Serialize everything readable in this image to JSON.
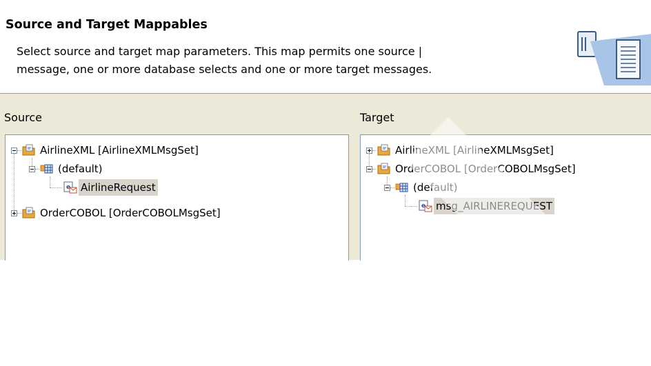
{
  "header": {
    "title": "Source and Target Mappables",
    "description_line1": "Select source and target map parameters. This map permits one source |",
    "description_line2": "message, one or more database selects and one or more target messages."
  },
  "source": {
    "label": "Source",
    "nodes": [
      {
        "label": "AirlineXML [AirlineXMLMsgSet]",
        "icon": "message-set-icon",
        "expander": "minus"
      },
      {
        "label": "(default)",
        "icon": "message-category-icon",
        "expander": "minus"
      },
      {
        "label": "AirlineRequest",
        "icon": "message-icon",
        "selected": true
      },
      {
        "label": "OrderCOBOL [OrderCOBOLMsgSet]",
        "icon": "message-set-icon",
        "expander": "plus"
      }
    ]
  },
  "target": {
    "label": "Target",
    "nodes": [
      {
        "label": "AirlineXML [AirlineXMLMsgSet]",
        "icon": "message-set-icon",
        "expander": "plus"
      },
      {
        "label": "OrderCOBOL [OrderCOBOLMsgSet]",
        "icon": "message-set-icon",
        "expander": "minus"
      },
      {
        "label": "(default)",
        "icon": "message-category-icon",
        "expander": "minus"
      },
      {
        "label": "msg_AIRLINEREQUEST",
        "icon": "message-icon",
        "selected": true
      }
    ]
  },
  "colors": {
    "panel_background": "#ece9d8",
    "tree_border": "#7f9db9",
    "selection": "#d8d4cc",
    "folder": "#e8a83a"
  }
}
